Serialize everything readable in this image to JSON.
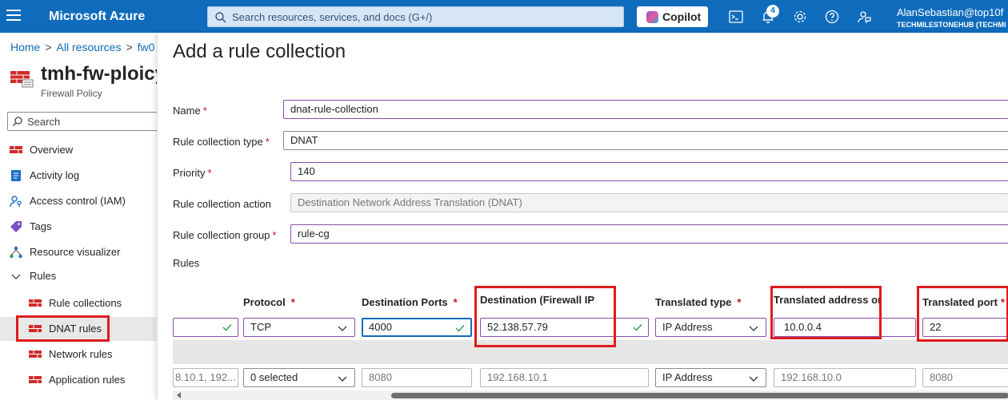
{
  "topbar": {
    "brand": "Microsoft Azure",
    "search_placeholder": "Search resources, services, and docs (G+/)",
    "copilot_label": "Copilot",
    "notification_count": "4",
    "user_name": "AlanSebastian@top10f",
    "user_tenant": "TECHMILESTONEHUB (TECHMI"
  },
  "breadcrumb": {
    "home": "Home",
    "all_resources": "All resources",
    "current": "fw0"
  },
  "resource": {
    "title": "tmh-fw-ploicy",
    "subtitle": "Firewall Policy"
  },
  "left_search": {
    "placeholder": "Search"
  },
  "nav": {
    "overview": "Overview",
    "activity_log": "Activity log",
    "access_control": "Access control (IAM)",
    "tags": "Tags",
    "resource_visualizer": "Resource visualizer",
    "rules": "Rules",
    "rule_collections": "Rule collections",
    "dnat_rules": "DNAT rules",
    "network_rules": "Network rules",
    "application_rules": "Application rules"
  },
  "blade": {
    "title": "Add a rule collection",
    "name_label": "Name",
    "name_value": "dnat-rule-collection",
    "type_label": "Rule collection type",
    "type_value": "DNAT",
    "priority_label": "Priority",
    "priority_value": "140",
    "action_label": "Rule collection action",
    "action_value": "Destination Network Address Translation (DNAT)",
    "group_label": "Rule collection group",
    "group_value": "rule-cg",
    "rules_label": "Rules",
    "required_mark": "*"
  },
  "rules_table": {
    "headers": {
      "protocol": "Protocol",
      "dest_ports": "Destination Ports",
      "destination": "Destination (Firewall IP",
      "translated_type": "Translated type",
      "translated_address": "Translated address or",
      "translated_port": "Translated port"
    },
    "row1": {
      "protocol": "TCP",
      "dest_ports": "4000",
      "destination": "52.138.57.79",
      "translated_type": "IP Address",
      "translated_address": "10.0.0.4",
      "translated_port": "22"
    },
    "row2": {
      "source": "8.10.1, 192...",
      "protocol": "0 selected",
      "dest_ports": "8080",
      "destination": "192.168.10.1",
      "translated_type": "IP Address",
      "translated_address": "192.168.10.0",
      "translated_port": "8080"
    }
  },
  "colors": {
    "azure_blue": "#0f6cbd",
    "highlight_red": "#e01b1b",
    "input_purple": "#8a4ea8"
  }
}
